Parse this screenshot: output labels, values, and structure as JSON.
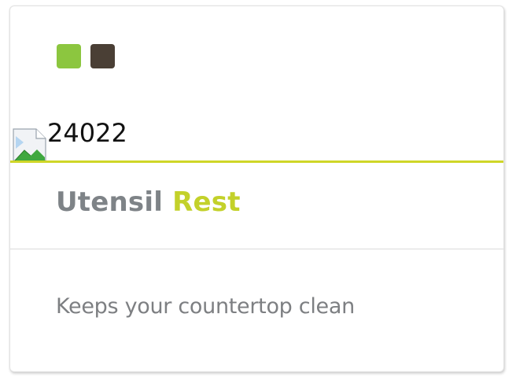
{
  "product": {
    "sku": "24022",
    "title_part1": "Utensil",
    "title_part2": "Rest",
    "description": "Keeps your countertop clean"
  },
  "swatches": [
    {
      "name": "lime-green",
      "color": "#8cc63f"
    },
    {
      "name": "dark-brown",
      "color": "#4a3f35"
    }
  ],
  "accent_color": "#cfd628",
  "image": {
    "icon": "broken-image-icon"
  }
}
